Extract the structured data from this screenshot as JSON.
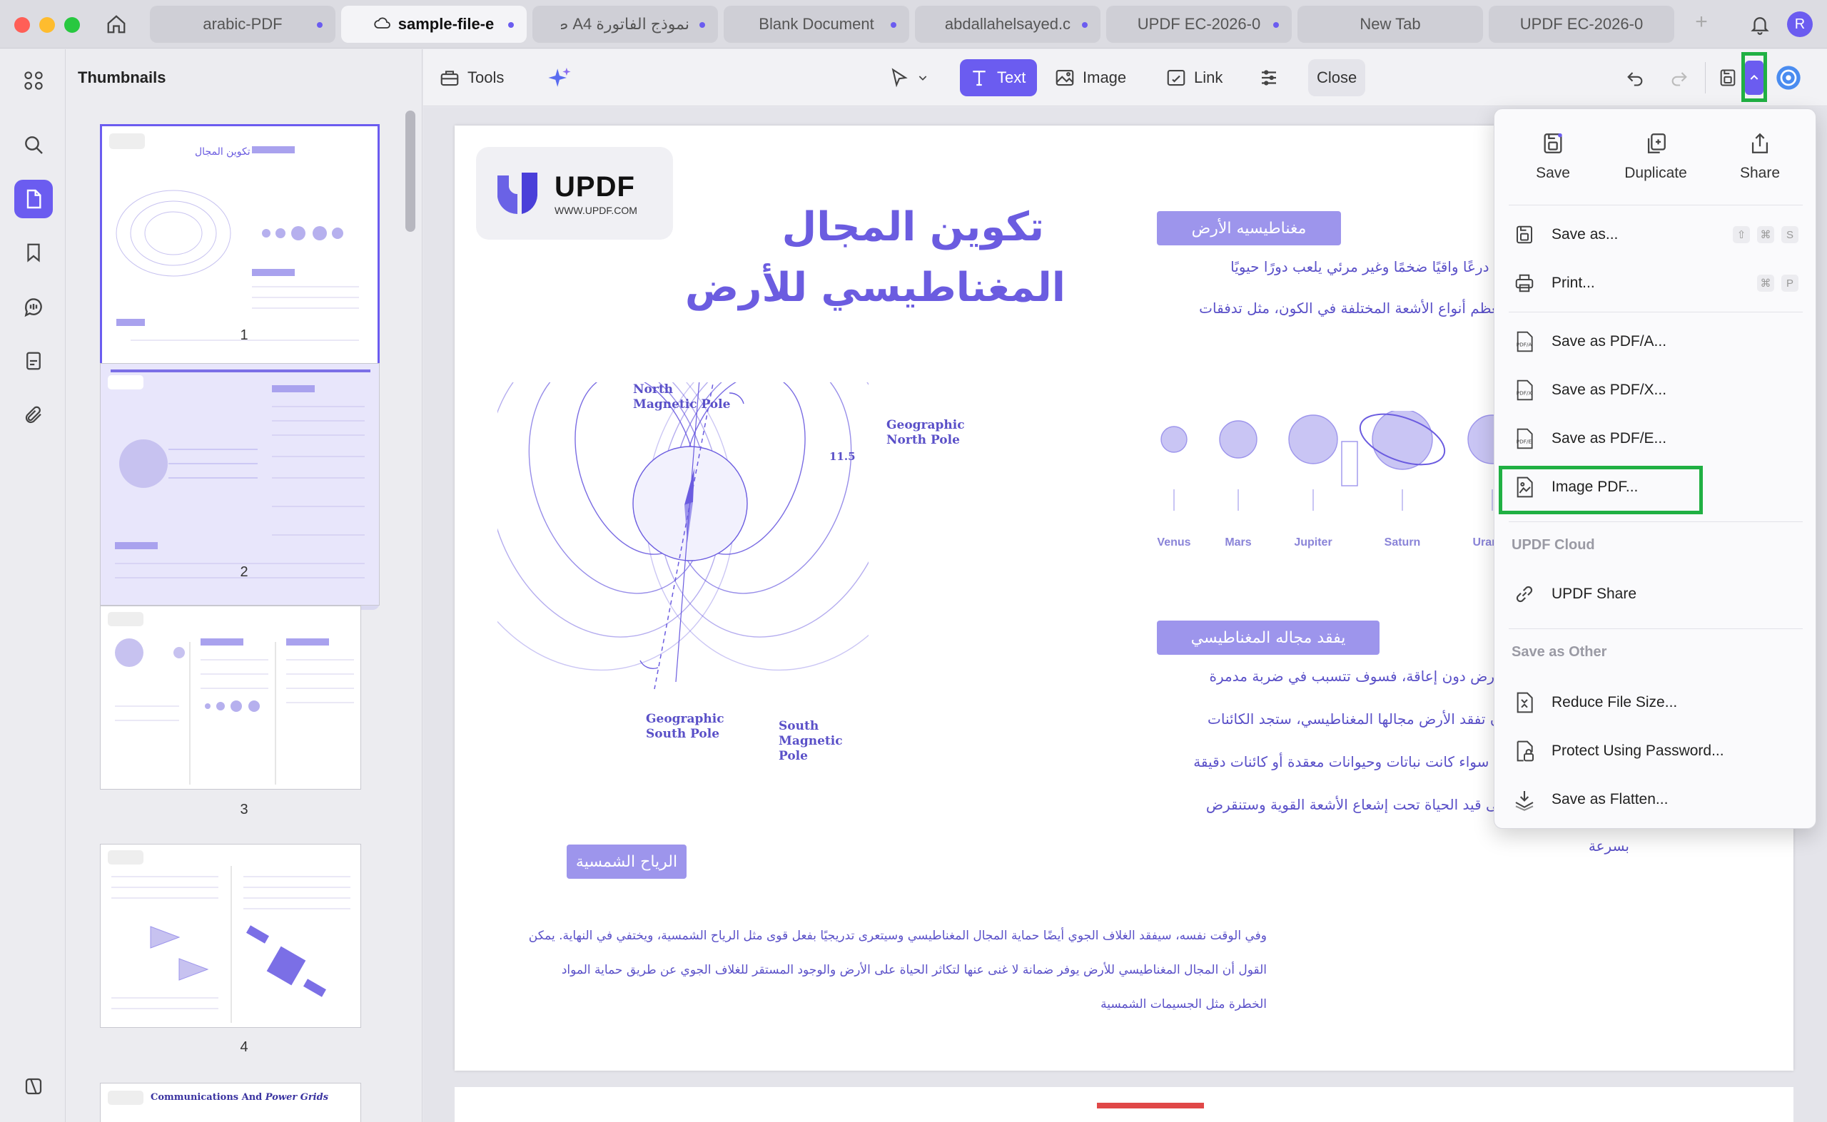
{
  "tabs": [
    {
      "label": "arabic-PDF",
      "active": false
    },
    {
      "label": "sample-file-e",
      "active": true
    },
    {
      "label": "نموذج الفاتورة A4 ط",
      "active": false
    },
    {
      "label": "Blank Document",
      "active": false
    },
    {
      "label": "abdallahelsayed.c",
      "active": false
    },
    {
      "label": "UPDF EC-2026-0",
      "active": false
    },
    {
      "label": "New Tab",
      "active": false
    },
    {
      "label": "UPDF EC-2026-0",
      "active": false
    }
  ],
  "user": {
    "initial": "R"
  },
  "thumbnails": {
    "title": "Thumbnails",
    "pages": [
      "1",
      "2",
      "3",
      "4"
    ],
    "page5_heading_a": "Communications And",
    "page5_heading_b": "Power Grids"
  },
  "toolbar": {
    "tools_label": "Tools",
    "text_label": "Text",
    "image_label": "Image",
    "link_label": "Link",
    "close_label": "Close"
  },
  "document": {
    "logo_name": "UPDF",
    "logo_url": "WWW.UPDF.COM",
    "title_line1": "تكوين المجال",
    "title_line2": "المغناطيسي للأرض",
    "section1_title": "مغناطيسيه الأرض",
    "section1_lines": [
      "يشبه درعًا واقيًا ضخمًا وغير مرئي يلعب دورًا حيويًا",
      "ية معظم أنواع الأشعة المختلفة في الكون، مثل تدفقات"
    ],
    "section2_title": "يفقد مجاله المغناطيسي",
    "section2_lines": [
      "ى الأرض دون إعاقة، فسوف تتسبب في ضربة مدمرة",
      "رد أن تفقد الأرض مجالها المغناطيسي، ستجد الكائنات",
      "رض، سواء كانت نباتات وحيوانات معقدة أو كائنات دقيقة",
      "ء على قيد الحياة تحت إشعاع الأشعة القوية وستنقرض",
      "بسرعة"
    ],
    "section3_title": "الرياح الشمسية",
    "footer_lines": [
      "وفي الوقت نفسه، سيفقد الغلاف الجوي أيضًا حماية المجال المغناطيسي وسيتعرى تدريجيًا بفعل قوى مثل الرياح الشمسية، ويختفي في النهاية. يمكن",
      "القول أن المجال المغناطيسي للأرض يوفر ضمانة لا غنى عنها لتكاثر الحياة على الأرض والوجود المستقر للغلاف الجوي عن طريق حماية المواد",
      "الخطرة مثل الجسيمات الشمسية"
    ],
    "diagram": {
      "north_magnetic_1": "North",
      "north_magnetic_2": "Magnetic Pole",
      "geo_north_1": "Geographic",
      "geo_north_2": "North Pole",
      "tilt": "11.5",
      "geo_south_1": "Geographic",
      "geo_south_2": "South Pole",
      "south_magnetic_1": "South",
      "south_magnetic_2": "Magnetic",
      "south_magnetic_3": "Pole"
    },
    "planets": [
      "Venus",
      "Mars",
      "Jupiter",
      "Saturn",
      "Uranus"
    ]
  },
  "menu": {
    "quick": {
      "save": "Save",
      "duplicate": "Duplicate",
      "share": "Share"
    },
    "items": {
      "save_as": "Save as...",
      "print": "Print...",
      "pdfa": "Save as PDF/A...",
      "pdfx": "Save as PDF/X...",
      "pdfe": "Save as PDF/E...",
      "image_pdf": "Image PDF...",
      "updf_share": "UPDF Share",
      "reduce": "Reduce File Size...",
      "protect": "Protect Using Password...",
      "flatten": "Save as Flatten..."
    },
    "sections": {
      "cloud": "UPDF Cloud",
      "other": "Save as Other"
    },
    "shortcuts": {
      "save_as": [
        "⇧",
        "⌘",
        "S"
      ],
      "print": [
        "⌘",
        "P"
      ]
    },
    "icon_badges": {
      "pdfa": "PDF/A",
      "pdfx": "PDF/X",
      "pdfe": "PDF/E"
    }
  },
  "colors": {
    "accent": "#6b5cf0",
    "highlight": "#20b043"
  }
}
